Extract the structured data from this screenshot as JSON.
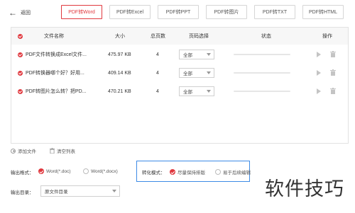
{
  "header": {
    "back_label": "返回"
  },
  "tabs": [
    {
      "label": "PDF转Word",
      "active": true
    },
    {
      "label": "PDF转Excel",
      "active": false
    },
    {
      "label": "PDF转PPT",
      "active": false
    },
    {
      "label": "PDF转图片",
      "active": false
    },
    {
      "label": "PDF转TXT",
      "active": false
    },
    {
      "label": "PDF转HTML",
      "active": false
    }
  ],
  "table": {
    "headers": {
      "name": "文件名称",
      "size": "大小",
      "pages": "总页数",
      "page_select": "页码选择",
      "status": "状态",
      "actions": "操作"
    },
    "rows": [
      {
        "name": "PDF文件转换成Excel文件...",
        "size": "475.97 KB",
        "pages": "4",
        "page_select": "全部"
      },
      {
        "name": "PDF转换器哪个好？好用...",
        "size": "409.14 KB",
        "pages": "4",
        "page_select": "全部"
      },
      {
        "name": "PDF转图片怎么转？把PD...",
        "size": "470.21 KB",
        "pages": "4",
        "page_select": "全部"
      }
    ]
  },
  "toolbar": {
    "add_file": "添加文件",
    "clear_list": "清空列表"
  },
  "output_format": {
    "label": "输出格式：",
    "options": [
      {
        "label": "Word(*.doc)",
        "selected": true
      },
      {
        "label": "Word(*.docx)",
        "selected": false
      }
    ]
  },
  "convert_mode": {
    "label": "转化模式：",
    "options": [
      {
        "label": "尽量保持排版",
        "selected": true
      },
      {
        "label": "易于后续编辑",
        "selected": false
      }
    ]
  },
  "output_dir": {
    "label": "输出目录：",
    "value": "原文件目录"
  },
  "watermark": "软件技巧",
  "colors": {
    "accent": "#e0383e",
    "focus": "#3d8be6"
  }
}
